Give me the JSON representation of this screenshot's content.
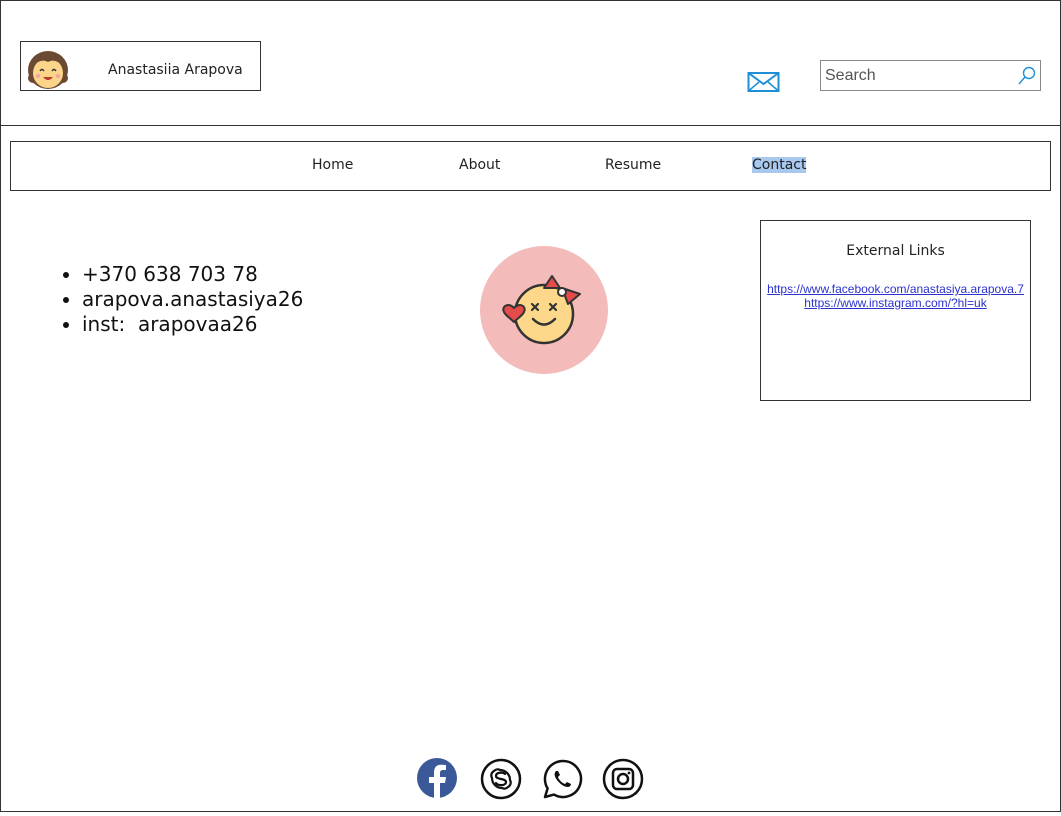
{
  "header": {
    "brand_name": "Anastasiia Arapova",
    "search": {
      "placeholder": "Search",
      "value": ""
    },
    "mail_icon": "envelope-icon",
    "search_icon": "magnifier-icon"
  },
  "nav": {
    "items": [
      {
        "label": "Home"
      },
      {
        "label": "About"
      },
      {
        "label": "Resume"
      },
      {
        "label": "Contact",
        "selected": true
      }
    ],
    "highlight_color": "#a8c8ee"
  },
  "contacts": {
    "phone": "+370 638 703 78",
    "email": "arapova.anastasiya26",
    "inst_label": "inst:",
    "inst_handle": "arapovaa26"
  },
  "external_links": {
    "title": "External Links",
    "links": [
      "https://www.facebook.com/anastasiya.arapova.7",
      "https://www.instagram.com/?hl=uk"
    ]
  },
  "social": [
    "facebook-icon",
    "skype-icon",
    "whatsapp-icon",
    "instagram-icon"
  ],
  "colors": {
    "avatar_circle": "#f4bbbb",
    "mail_icon": "#1f8fd6",
    "facebook": "#3b5998",
    "link": "#2b33cc"
  }
}
